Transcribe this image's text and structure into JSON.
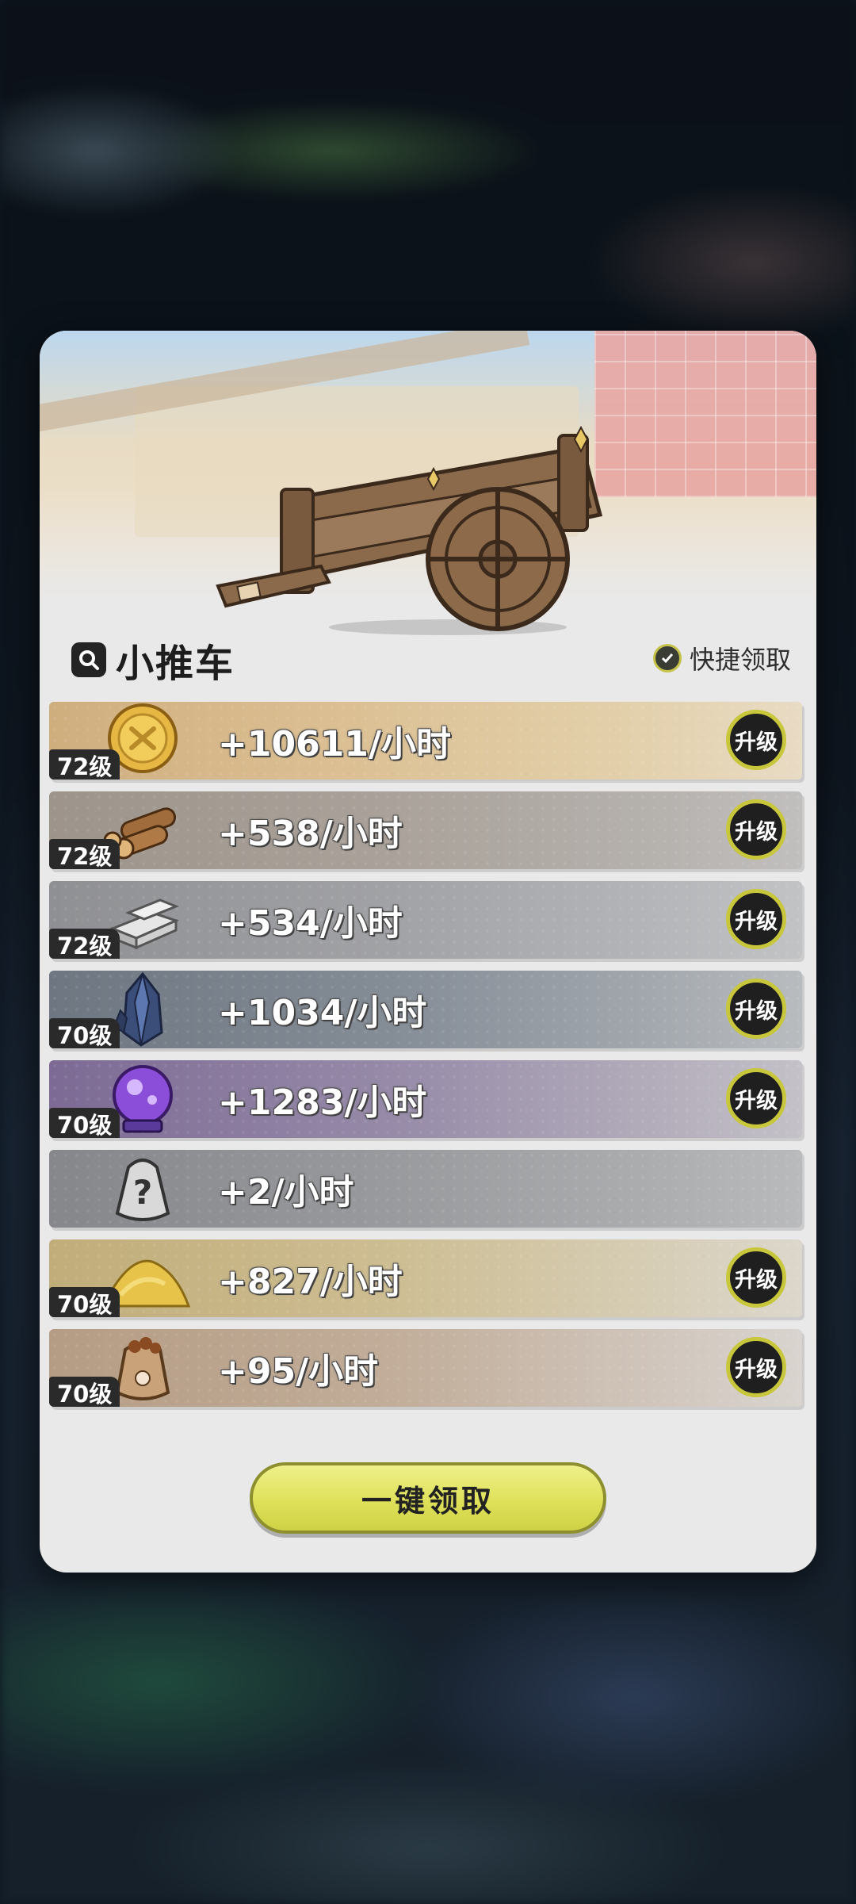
{
  "panel": {
    "title": "小推车",
    "quick_claim_label": "快捷领取",
    "claim_all_label": "一键领取"
  },
  "rows": [
    {
      "level": "72级",
      "rate": "+10611/小时",
      "upgrade_label": "升级",
      "item_icon": "gold-coin-icon",
      "color": "#d7b98a"
    },
    {
      "level": "72级",
      "rate": "+538/小时",
      "upgrade_label": "升级",
      "item_icon": "wood-logs-icon",
      "color": "#a79f97"
    },
    {
      "level": "72级",
      "rate": "+534/小时",
      "upgrade_label": "升级",
      "item_icon": "stone-blocks-icon",
      "color": "#a2a3a6"
    },
    {
      "level": "70级",
      "rate": "+1034/小时",
      "upgrade_label": "升级",
      "item_icon": "iron-crystal-icon",
      "color": "#8b939d"
    },
    {
      "level": "70级",
      "rate": "+1283/小时",
      "upgrade_label": "升级",
      "item_icon": "magic-orb-icon",
      "color": "#9d91aa"
    },
    {
      "level": "",
      "rate": "+2/小时",
      "upgrade_label": "",
      "item_icon": "mystery-sack-icon",
      "color": "#9a9b9e"
    },
    {
      "level": "70级",
      "rate": "+827/小时",
      "upgrade_label": "升级",
      "item_icon": "gold-sand-icon",
      "color": "#cdbf9a"
    },
    {
      "level": "70级",
      "rate": "+95/小时",
      "upgrade_label": "升级",
      "item_icon": "food-sack-icon",
      "color": "#c4b19f"
    }
  ]
}
